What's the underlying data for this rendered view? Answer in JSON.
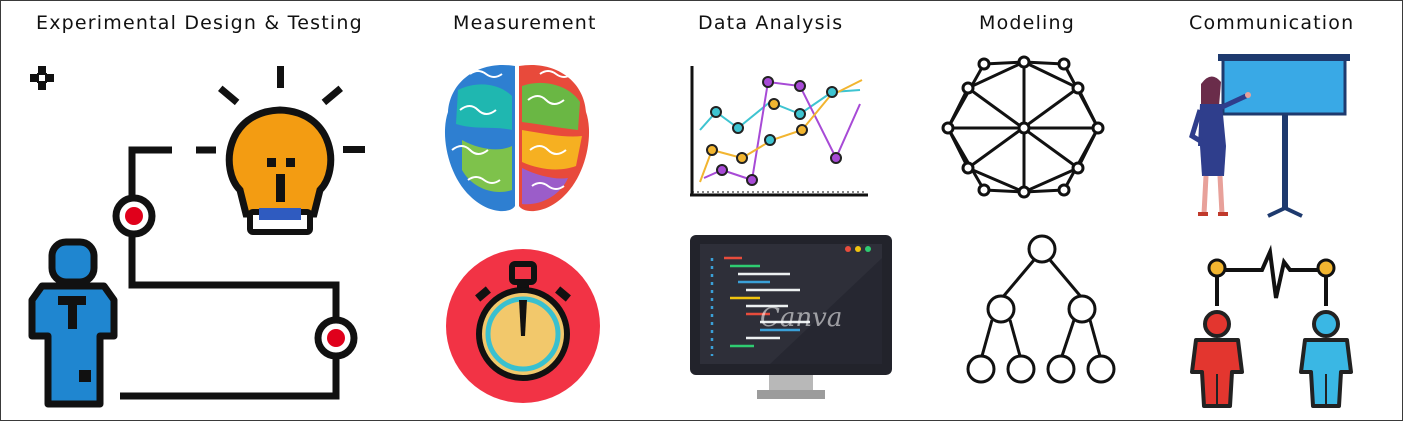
{
  "columns": [
    {
      "id": "experimental",
      "title": "Experimental Design & Testing"
    },
    {
      "id": "measurement",
      "title": "Measurement"
    },
    {
      "id": "data_analysis",
      "title": "Data Analysis"
    },
    {
      "id": "modeling",
      "title": "Modeling"
    },
    {
      "id": "communication",
      "title": "Communication"
    }
  ],
  "watermark": "Canva",
  "icons": [
    "puzzle-icon",
    "person-icon",
    "lightbulb-icon",
    "workflow-path",
    "brain-icon",
    "stopwatch-icon",
    "line-chart-icon",
    "computer-monitor-icon",
    "network-icon",
    "tree-diagram-icon",
    "presenter-icon",
    "people-connection-icon"
  ],
  "colors": {
    "lightbulb": "#f39c12",
    "person": "#1f86d0",
    "stopwatch_bg": "#f23345",
    "stopwatch_face": "#f2c86b",
    "chart_teal": "#3ec4d1",
    "chart_purple": "#a74ad6",
    "chart_orange": "#f2b530",
    "screen": "#22232b",
    "red_person": "#e3362f",
    "blue_person": "#3ab7e4"
  }
}
